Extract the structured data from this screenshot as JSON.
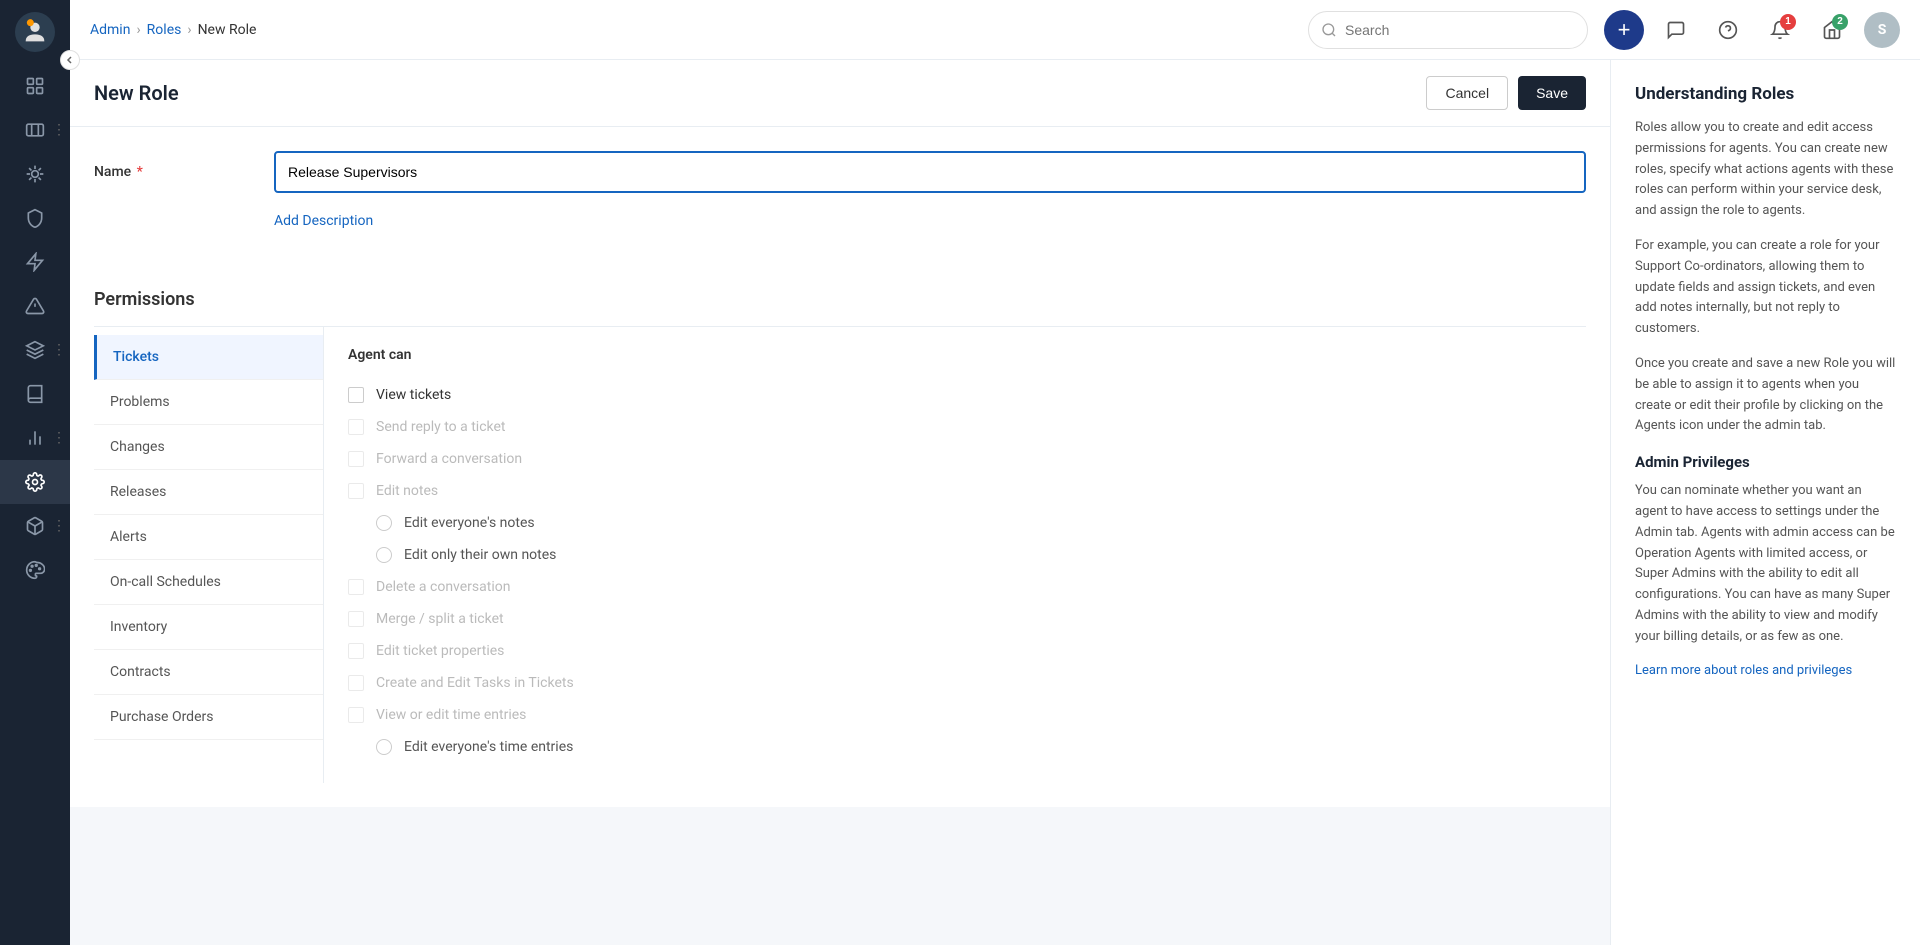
{
  "app": {
    "sidebar_items": [
      {
        "id": "dashboard",
        "icon": "grid",
        "active": false
      },
      {
        "id": "tickets",
        "icon": "ticket",
        "active": false
      },
      {
        "id": "bugs",
        "icon": "bug",
        "active": false
      },
      {
        "id": "shield",
        "icon": "shield",
        "active": false
      },
      {
        "id": "lightning",
        "icon": "lightning",
        "active": false
      },
      {
        "id": "alert",
        "icon": "alert",
        "active": false
      },
      {
        "id": "layers",
        "icon": "layers",
        "active": false
      },
      {
        "id": "book",
        "icon": "book",
        "active": false
      },
      {
        "id": "chart",
        "icon": "chart",
        "active": false
      },
      {
        "id": "settings",
        "icon": "settings",
        "active": true
      },
      {
        "id": "box",
        "icon": "box",
        "active": false
      },
      {
        "id": "palette",
        "icon": "palette",
        "active": false
      }
    ]
  },
  "topbar": {
    "breadcrumb": {
      "admin": "Admin",
      "roles": "Roles",
      "current": "New Role"
    },
    "search_placeholder": "Search",
    "notification_count_1": "1",
    "notification_count_2": "2",
    "user_initial": "S"
  },
  "page": {
    "title": "New Role",
    "cancel_label": "Cancel",
    "save_label": "Save"
  },
  "form": {
    "name_label": "Name",
    "name_value": "Release Supervisors",
    "add_description": "Add Description"
  },
  "permissions": {
    "title": "Permissions",
    "nav_items": [
      {
        "id": "tickets",
        "label": "Tickets",
        "active": true
      },
      {
        "id": "problems",
        "label": "Problems",
        "active": false
      },
      {
        "id": "changes",
        "label": "Changes",
        "active": false
      },
      {
        "id": "releases",
        "label": "Releases",
        "active": false
      },
      {
        "id": "alerts",
        "label": "Alerts",
        "active": false
      },
      {
        "id": "oncall",
        "label": "On-call Schedules",
        "active": false
      },
      {
        "id": "inventory",
        "label": "Inventory",
        "active": false
      },
      {
        "id": "contracts",
        "label": "Contracts",
        "active": false
      },
      {
        "id": "purchase_orders",
        "label": "Purchase Orders",
        "active": false
      }
    ],
    "agent_can": "Agent can",
    "permission_items": [
      {
        "id": "view_tickets",
        "type": "checkbox",
        "label": "View tickets",
        "checked": false,
        "disabled": false
      },
      {
        "id": "send_reply",
        "type": "checkbox",
        "label": "Send reply to a ticket",
        "checked": false,
        "disabled": true
      },
      {
        "id": "forward_conv",
        "type": "checkbox",
        "label": "Forward a conversation",
        "checked": false,
        "disabled": true
      },
      {
        "id": "edit_notes",
        "type": "checkbox",
        "label": "Edit notes",
        "checked": false,
        "disabled": true
      },
      {
        "id": "edit_everyones_notes",
        "type": "radio",
        "label": "Edit everyone's notes",
        "checked": false,
        "disabled": false
      },
      {
        "id": "edit_own_notes",
        "type": "radio",
        "label": "Edit only their own notes",
        "checked": false,
        "disabled": false
      },
      {
        "id": "delete_conversation",
        "type": "checkbox",
        "label": "Delete a conversation",
        "checked": false,
        "disabled": true
      },
      {
        "id": "merge_split",
        "type": "checkbox",
        "label": "Merge / split a ticket",
        "checked": false,
        "disabled": true
      },
      {
        "id": "edit_ticket_props",
        "type": "checkbox",
        "label": "Edit ticket properties",
        "checked": false,
        "disabled": true
      },
      {
        "id": "create_edit_tasks",
        "type": "checkbox",
        "label": "Create and Edit Tasks in Tickets",
        "checked": false,
        "disabled": true
      },
      {
        "id": "view_edit_time",
        "type": "checkbox",
        "label": "View or edit time entries",
        "checked": false,
        "disabled": true
      },
      {
        "id": "edit_everyones_time",
        "type": "radio",
        "label": "Edit everyone's time entries",
        "checked": false,
        "disabled": false
      }
    ]
  },
  "help_sidebar": {
    "title": "Understanding Roles",
    "para1": "Roles allow you to create and edit access permissions for agents. You can create new roles, specify what actions agents with these roles can perform within your service desk, and assign the role to agents.",
    "para2": "For example, you can create a role for your Support Co-ordinators, allowing them to update fields and assign tickets, and even add notes internally, but not reply to customers.",
    "para3": "Once you create and save a new Role you will be able to assign it to agents when you create or edit their profile by clicking on the Agents icon under the admin tab.",
    "admin_title": "Admin Privileges",
    "admin_para": "You can nominate whether you want an agent to have access to settings under the Admin tab. Agents with admin access can be Operation Agents with limited access, or Super Admins with the ability to edit all configurations. You can have as many Super Admins with the ability to view and modify your billing details, or as few as one.",
    "learn_more": "Learn more about roles and privileges"
  }
}
